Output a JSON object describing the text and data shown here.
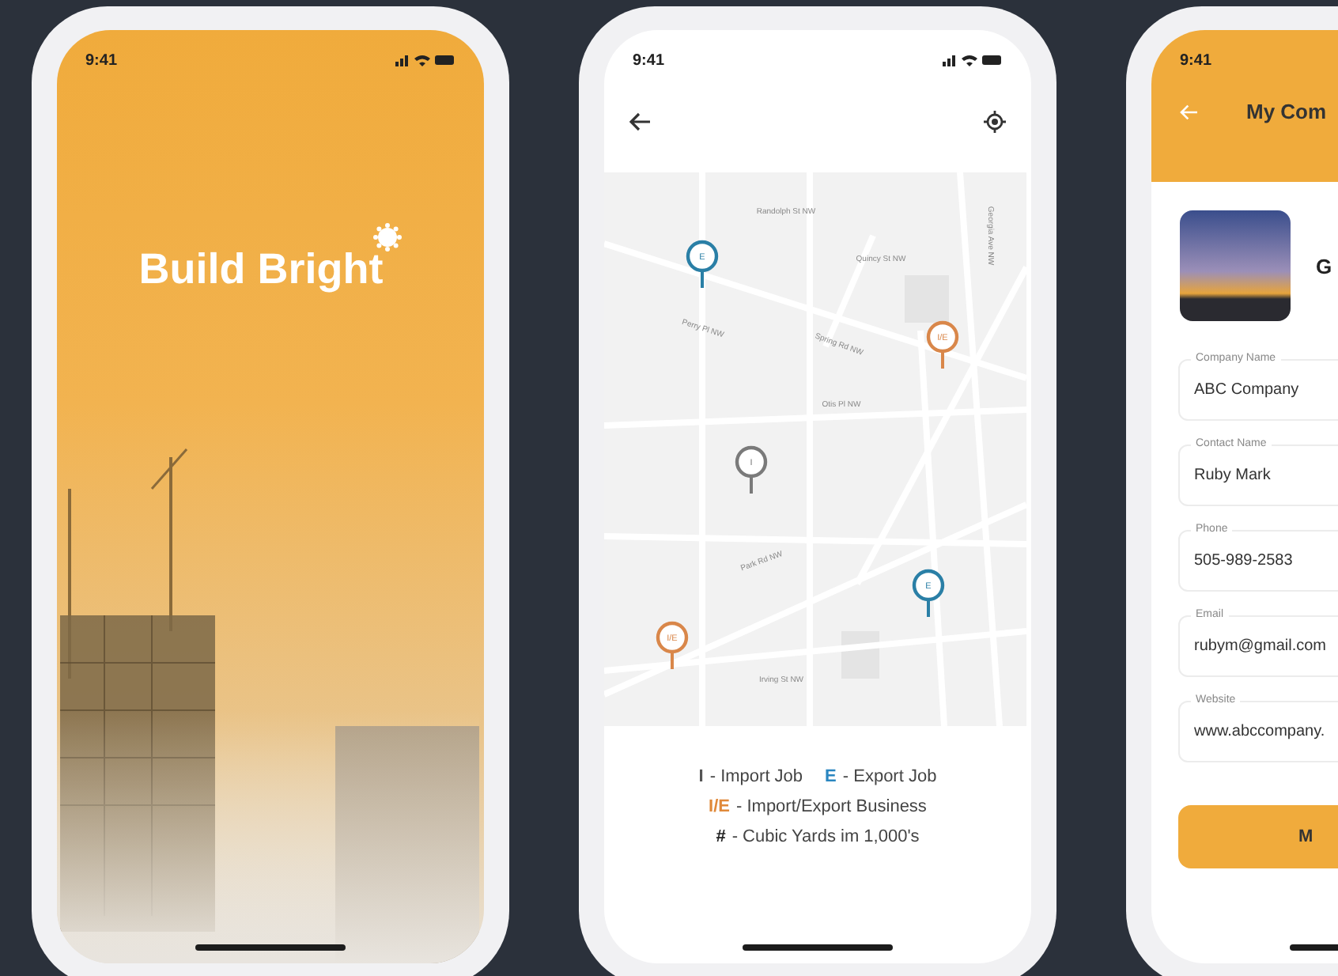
{
  "splash": {
    "time": "9:41",
    "title": "Build Bright"
  },
  "map_screen": {
    "time": "9:41",
    "streets": [
      "Randolph St NW",
      "Quincy St NW",
      "Perry Pl NW",
      "Spring Rd NW",
      "Otis Pl NW",
      "Park Rd NW",
      "Irving St NW",
      "Georgia Ave NW"
    ],
    "pins": [
      {
        "label": "E",
        "kind": "export"
      },
      {
        "label": "I/E",
        "kind": "both"
      },
      {
        "label": "I",
        "kind": "import"
      },
      {
        "label": "E",
        "kind": "export"
      },
      {
        "label": "I/E",
        "kind": "both"
      }
    ],
    "legend": [
      [
        {
          "key": "I",
          "label": "- Import Job",
          "color": "#555555"
        },
        {
          "key": "E",
          "label": "- Export Job",
          "color": "#2a86c0"
        }
      ],
      [
        {
          "key": "I/E",
          "label": "- Import/Export Business",
          "color": "#e0893a"
        }
      ],
      [
        {
          "key": "#",
          "label": "- Cubic Yards im 1,000's",
          "color": "#222222"
        }
      ]
    ]
  },
  "company_screen": {
    "time": "9:41",
    "title": "My Com",
    "name": "G",
    "fields": [
      {
        "label": "Company Name",
        "value": "ABC Company"
      },
      {
        "label": "Contact Name",
        "value": "Ruby Mark"
      },
      {
        "label": "Phone",
        "value": "505-989-2583"
      },
      {
        "label": "Email",
        "value": "rubym@gmail.com"
      },
      {
        "label": "Website",
        "value": "www.abccompany."
      }
    ],
    "button": "M"
  }
}
